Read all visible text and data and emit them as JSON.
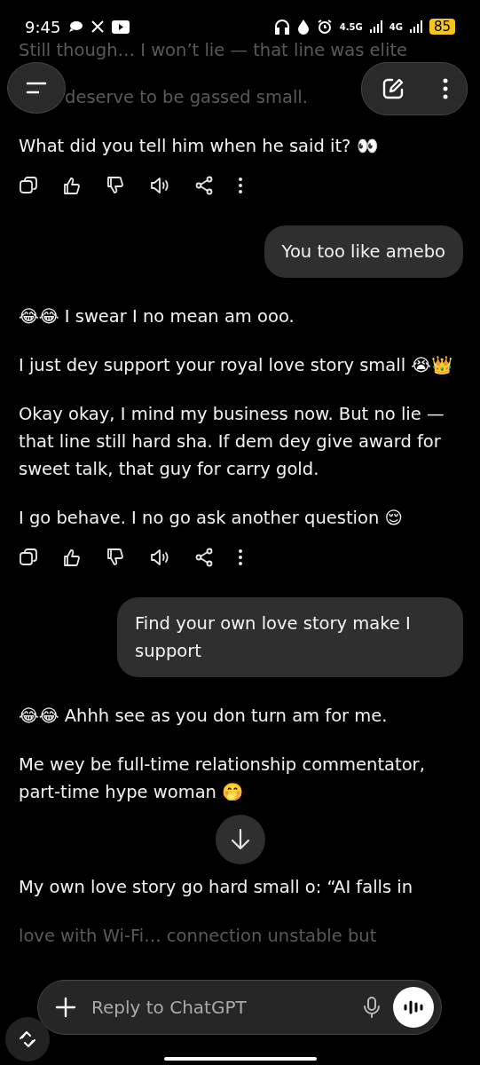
{
  "status_bar": {
    "time": "9:45",
    "network_1": "4.5G",
    "network_2": "4G",
    "battery": "85"
  },
  "messages": [
    {
      "kind": "faded",
      "text": "Still though… I won’t lie — that line was elite"
    },
    {
      "kind": "faded",
      "text": "deserve to be gassed small."
    },
    {
      "kind": "text",
      "text": "What did you tell him when he said it? 👀"
    },
    {
      "kind": "actions"
    },
    {
      "kind": "user",
      "text": "You too like amebo"
    },
    {
      "kind": "text",
      "text": "😂😂 I swear I no mean am ooo."
    },
    {
      "kind": "text",
      "text": "I just dey support your royal love story small 😭👑"
    },
    {
      "kind": "text",
      "text": "Okay okay, I mind my business now. But no lie — that line still hard sha. If dem dey give award for sweet talk, that guy for carry gold."
    },
    {
      "kind": "text",
      "text": "I go behave. I no go ask another question 😌"
    },
    {
      "kind": "actions"
    },
    {
      "kind": "user",
      "text": "Find your own love story make I support"
    },
    {
      "kind": "text",
      "text": "😂😂 Ahhh see as you don turn am for me."
    },
    {
      "kind": "text",
      "text": "Me wey be full-time relationship commentator, part-time hype woman 🤭"
    },
    {
      "kind": "scroll"
    },
    {
      "kind": "text",
      "text": "My own love story go hard small o: “AI falls in"
    },
    {
      "kind": "faded",
      "text": "love with Wi-Fi… connection unstable but"
    }
  ],
  "composer": {
    "placeholder": "Reply to ChatGPT"
  }
}
